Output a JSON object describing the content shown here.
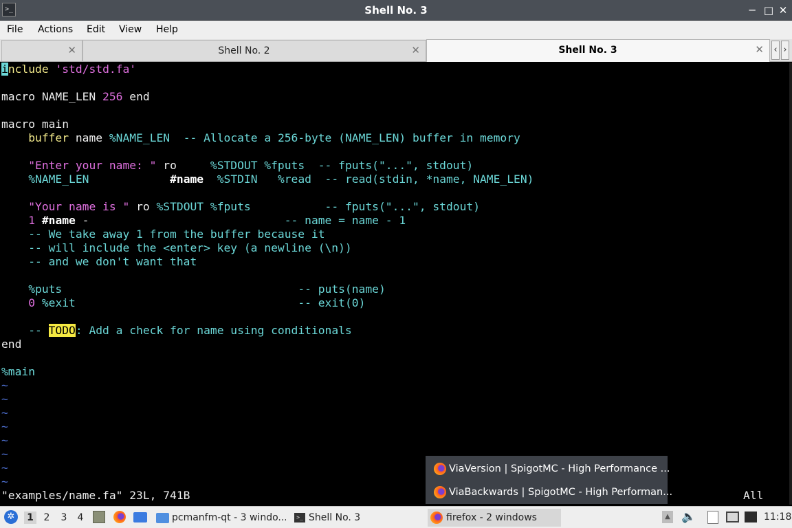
{
  "window": {
    "title": "Shell No. 3",
    "app_icon": "terminal-icon",
    "controls": {
      "minimize": "─",
      "maximize": "□",
      "close": "✕"
    }
  },
  "menu": [
    "File",
    "Actions",
    "Edit",
    "View",
    "Help"
  ],
  "tabs": [
    {
      "label": "",
      "close": "✕"
    },
    {
      "label": "Shell No. 2",
      "close": "✕"
    },
    {
      "label": "Shell No. 3",
      "close": "✕"
    }
  ],
  "tab_nav": {
    "prev": "‹",
    "next": "›"
  },
  "editor": {
    "lines": [
      [
        {
          "t": "i",
          "c": "cursor"
        },
        {
          "t": "nclude",
          "c": "c-yellow"
        },
        {
          "t": " "
        },
        {
          "t": "'std/std.fa'",
          "c": "c-pink"
        }
      ],
      [],
      [
        {
          "t": "macro NAME_LEN "
        },
        {
          "t": "256",
          "c": "c-pink"
        },
        {
          "t": " end"
        }
      ],
      [],
      [
        {
          "t": "macro main"
        }
      ],
      [
        {
          "t": "    "
        },
        {
          "t": "buffer",
          "c": "c-yellow"
        },
        {
          "t": " name "
        },
        {
          "t": "%NAME_LEN",
          "c": "c-cyan"
        },
        {
          "t": "  -- Allocate a 256-byte (NAME_LEN) buffer in memory",
          "c": "c-cyan"
        }
      ],
      [],
      [
        {
          "t": "    "
        },
        {
          "t": "\"Enter your name: \"",
          "c": "c-pink"
        },
        {
          "t": " ro     "
        },
        {
          "t": "%STDOUT %fputs",
          "c": "c-cyan"
        },
        {
          "t": "  -- fputs(\"...\", stdout)",
          "c": "c-cyan"
        }
      ],
      [
        {
          "t": "    "
        },
        {
          "t": "%NAME_LEN",
          "c": "c-cyan"
        },
        {
          "t": "            "
        },
        {
          "t": "#name",
          "c": "c-bold"
        },
        {
          "t": "  "
        },
        {
          "t": "%STDIN   %read",
          "c": "c-cyan"
        },
        {
          "t": "  -- read(stdin, *name, NAME_LEN)",
          "c": "c-cyan"
        }
      ],
      [],
      [
        {
          "t": "    "
        },
        {
          "t": "\"Your name is \"",
          "c": "c-pink"
        },
        {
          "t": " ro "
        },
        {
          "t": "%STDOUT %fputs",
          "c": "c-cyan"
        },
        {
          "t": "           -- fputs(\"...\", stdout)",
          "c": "c-cyan"
        }
      ],
      [
        {
          "t": "    "
        },
        {
          "t": "1",
          "c": "c-pink"
        },
        {
          "t": " "
        },
        {
          "t": "#name",
          "c": "c-bold"
        },
        {
          "t": " -                             "
        },
        {
          "t": "-- name = name - 1",
          "c": "c-cyan"
        }
      ],
      [
        {
          "t": "    -- We take away 1 from the buffer because it",
          "c": "c-cyan"
        }
      ],
      [
        {
          "t": "    -- will include the <enter> key (a newline (\\n))",
          "c": "c-cyan"
        }
      ],
      [
        {
          "t": "    -- and we don't want that",
          "c": "c-cyan"
        }
      ],
      [],
      [
        {
          "t": "    "
        },
        {
          "t": "%puts",
          "c": "c-cyan"
        },
        {
          "t": "                                   "
        },
        {
          "t": "-- puts(name)",
          "c": "c-cyan"
        }
      ],
      [
        {
          "t": "    "
        },
        {
          "t": "0",
          "c": "c-pink"
        },
        {
          "t": " "
        },
        {
          "t": "%exit",
          "c": "c-cyan"
        },
        {
          "t": "                                 "
        },
        {
          "t": "-- exit(0)",
          "c": "c-cyan"
        }
      ],
      [],
      [
        {
          "t": "    -- ",
          "c": "c-cyan"
        },
        {
          "t": "TODO",
          "c": "todo"
        },
        {
          "t": ": Add a check for name using conditionals",
          "c": "c-cyan"
        }
      ],
      [
        {
          "t": "end"
        }
      ],
      [],
      [
        {
          "t": "%main",
          "c": "c-cyan"
        }
      ],
      [
        {
          "t": "~",
          "c": "c-tilde"
        }
      ],
      [
        {
          "t": "~",
          "c": "c-tilde"
        }
      ],
      [
        {
          "t": "~",
          "c": "c-tilde"
        }
      ],
      [
        {
          "t": "~",
          "c": "c-tilde"
        }
      ],
      [
        {
          "t": "~",
          "c": "c-tilde"
        }
      ],
      [
        {
          "t": "~",
          "c": "c-tilde"
        }
      ],
      [
        {
          "t": "~",
          "c": "c-tilde"
        }
      ],
      [
        {
          "t": "~",
          "c": "c-tilde"
        }
      ]
    ],
    "status_left": "\"examples/name.fa\" 23L, 741B",
    "status_right": "All"
  },
  "popup": [
    {
      "icon": "firefox-icon",
      "label": "ViaVersion | SpigotMC - High Performance ..."
    },
    {
      "icon": "firefox-icon",
      "label": "ViaBackwards | SpigotMC - High Performan..."
    }
  ],
  "taskbar": {
    "start_icon": "lxqt-start-icon",
    "desktops": [
      "1",
      "2",
      "3",
      "4"
    ],
    "active_desktop": "1",
    "launchers": [
      "file-manager-icon",
      "firefox-icon",
      "show-desktop-icon"
    ],
    "tasks": [
      {
        "icon": "folder-icon",
        "label": "pcmanfm-qt - 3 windo..."
      },
      {
        "icon": "terminal-icon",
        "label": "Shell No. 3"
      },
      {
        "icon": "firefox-icon",
        "label": "firefox - 2 windows"
      }
    ],
    "tray": [
      "tray-up-arrow-icon",
      "volume-icon",
      "clipboard-icon",
      "network-icon",
      "keyboard-layout-icon"
    ],
    "clock": "11:18"
  },
  "colors": {
    "terminal_bg": "#000000",
    "comment_cyan": "#6bd7d7",
    "string_pink": "#e070e0",
    "keyword_yellow": "#f1e88a",
    "tilde_blue": "#4d6fd0",
    "todo_highlight": "#f5e942",
    "titlebar": "#4a4f56",
    "popup_bg": "#3d4148"
  }
}
